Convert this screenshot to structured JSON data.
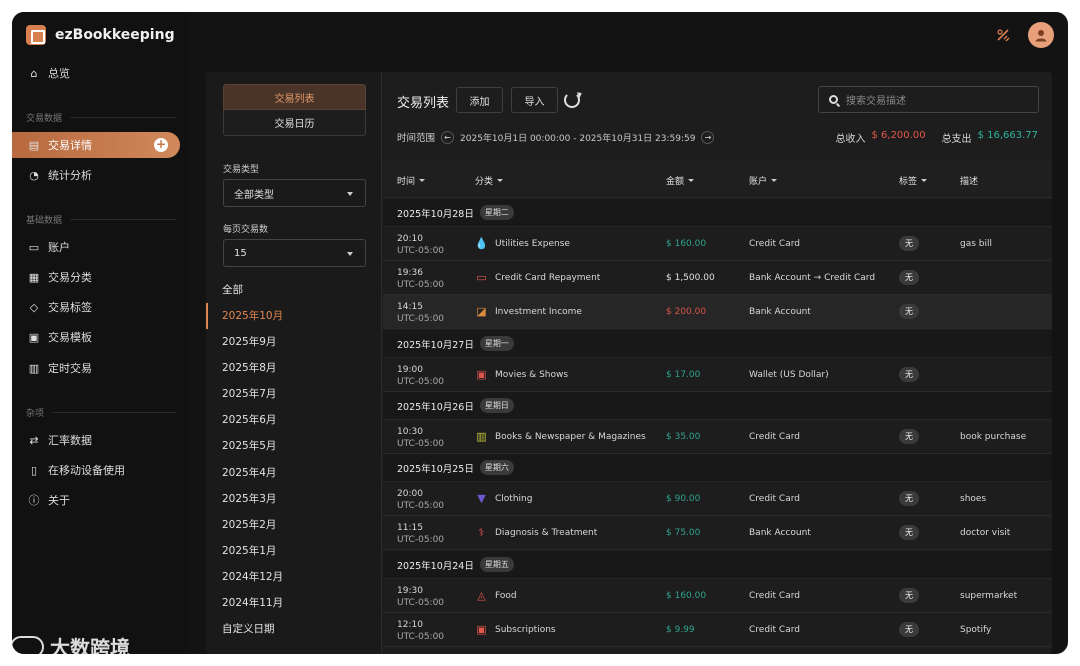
{
  "app": {
    "name": "ezBookkeeping"
  },
  "sidebar": {
    "overview": "总览",
    "sections": {
      "tx_data": "交易数据",
      "basic_data": "基础数据",
      "misc": "杂项"
    },
    "tx_detail": "交易详情",
    "stats": "统计分析",
    "accounts": "账户",
    "categories": "交易分类",
    "tags": "交易标签",
    "templates": "交易模板",
    "scheduled": "定时交易",
    "exchange_rates": "汇率数据",
    "mobile": "在移动设备使用",
    "about": "关于"
  },
  "left": {
    "seg_list": "交易列表",
    "seg_calendar": "交易日历",
    "type_label": "交易类型",
    "type_value": "全部类型",
    "per_page_label": "每页交易数",
    "per_page_value": "15",
    "months": [
      "全部",
      "2025年10月",
      "2025年9月",
      "2025年8月",
      "2025年7月",
      "2025年6月",
      "2025年5月",
      "2025年4月",
      "2025年3月",
      "2025年2月",
      "2025年1月",
      "2024年12月",
      "2024年11月",
      "自定义日期"
    ]
  },
  "main": {
    "title": "交易列表",
    "add": "添加",
    "import": "导入",
    "search_placeholder": "搜索交易描述",
    "range_label": "时间范围",
    "range_value": "2025年10月1日 00:00:00 - 2025年10月31日 23:59:59",
    "income_label": "总收入",
    "income_value": "$ 6,200.00",
    "expense_label": "总支出",
    "expense_value": "$ 16,663.77",
    "headers": {
      "time": "时间",
      "category": "分类",
      "amount": "金额",
      "account": "账户",
      "tags": "标签",
      "desc": "描述"
    }
  },
  "days": [
    {
      "date": "2025年10月28日",
      "weekday": "星期二"
    },
    {
      "date": "2025年10月27日",
      "weekday": "星期一"
    },
    {
      "date": "2025年10月26日",
      "weekday": "星期日"
    },
    {
      "date": "2025年10月25日",
      "weekday": "星期六"
    },
    {
      "date": "2025年10月24日",
      "weekday": "星期五"
    }
  ],
  "transactions": [
    {
      "time": "20:10",
      "tz": "UTC-05:00",
      "category": "Utilities Expense",
      "icon": "water-drop-icon",
      "icon_color": "#e0e0e0",
      "amount": "$ 160.00",
      "kind": "expense",
      "account": "Credit Card",
      "tag": "无",
      "desc": "gas bill"
    },
    {
      "time": "19:36",
      "tz": "UTC-05:00",
      "category": "Credit Card Repayment",
      "icon": "card-icon",
      "icon_color": "#e2574c",
      "amount": "$ 1,500.00",
      "kind": "transfer",
      "account": "Bank Account → Credit Card",
      "tag": "无",
      "desc": ""
    },
    {
      "time": "14:15",
      "tz": "UTC-05:00",
      "category": "Investment Income",
      "icon": "chart-icon",
      "icon_color": "#e08a3c",
      "amount": "$ 200.00",
      "kind": "income",
      "account": "Bank Account",
      "tag": "无",
      "desc": ""
    },
    {
      "time": "19:00",
      "tz": "UTC-05:00",
      "category": "Movies & Shows",
      "icon": "film-icon",
      "icon_color": "#d9544a",
      "amount": "$ 17.00",
      "kind": "expense",
      "account": "Wallet (US Dollar)",
      "tag": "无",
      "desc": ""
    },
    {
      "time": "10:30",
      "tz": "UTC-05:00",
      "category": "Books & Newspaper & Magazines",
      "icon": "book-icon",
      "icon_color": "#c7c43a",
      "amount": "$ 35.00",
      "kind": "expense",
      "account": "Credit Card",
      "tag": "无",
      "desc": "book purchase"
    },
    {
      "time": "20:00",
      "tz": "UTC-05:00",
      "category": "Clothing",
      "icon": "shirt-icon",
      "icon_color": "#6a5acd",
      "amount": "$ 90.00",
      "kind": "expense",
      "account": "Credit Card",
      "tag": "无",
      "desc": "shoes"
    },
    {
      "time": "11:15",
      "tz": "UTC-05:00",
      "category": "Diagnosis & Treatment",
      "icon": "stethoscope-icon",
      "icon_color": "#e2574c",
      "amount": "$ 75.00",
      "kind": "expense",
      "account": "Bank Account",
      "tag": "无",
      "desc": "doctor visit"
    },
    {
      "time": "19:30",
      "tz": "UTC-05:00",
      "category": "Food",
      "icon": "food-icon",
      "icon_color": "#e2574c",
      "amount": "$ 160.00",
      "kind": "expense",
      "account": "Credit Card",
      "tag": "无",
      "desc": "supermarket"
    },
    {
      "time": "12:10",
      "tz": "UTC-05:00",
      "category": "Subscriptions",
      "icon": "subscription-icon",
      "icon_color": "#e2574c",
      "amount": "$ 9.99",
      "kind": "expense",
      "account": "Credit Card",
      "tag": "无",
      "desc": "Spotify"
    }
  ],
  "watermark": "大数跨境"
}
